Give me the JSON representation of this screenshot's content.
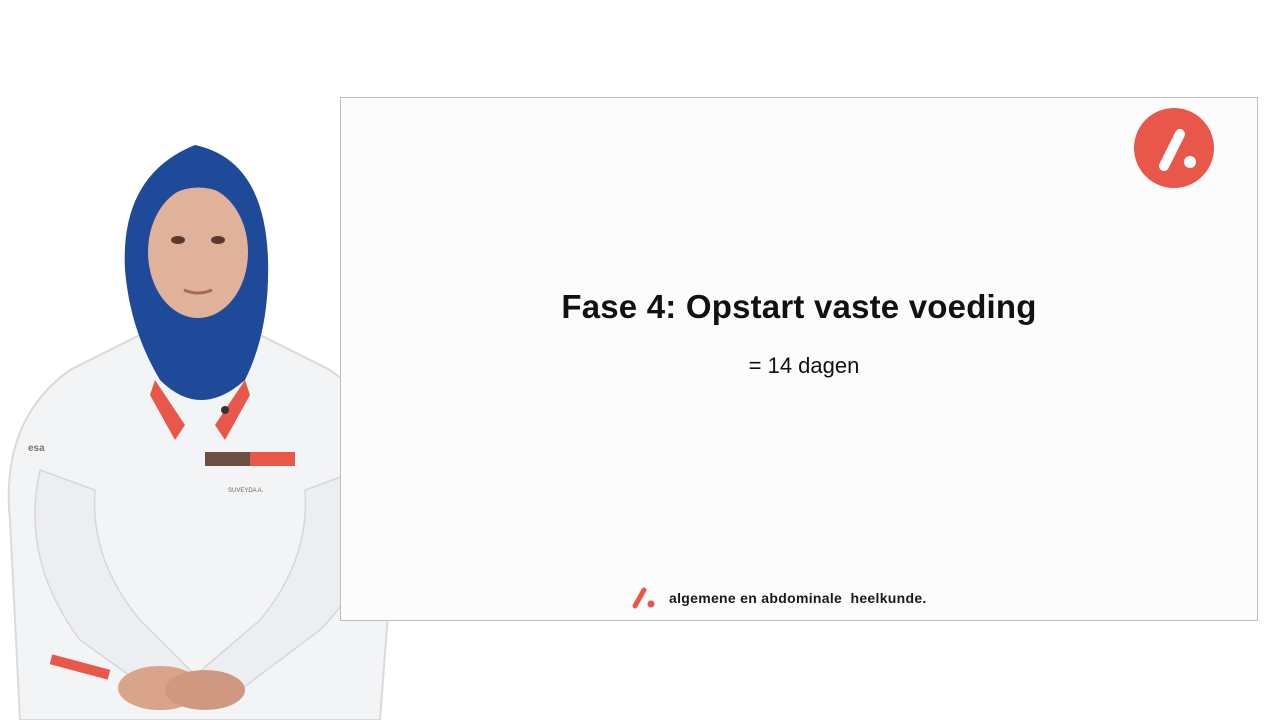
{
  "slide": {
    "title": "Fase 4: Opstart vaste voeding",
    "subtitle": "= 14 dagen",
    "footer_text": "algemene en abdominale  heelkunde."
  },
  "presenter": {
    "badge_name": "SUVEYDA A.",
    "logo_text": "esa"
  },
  "colors": {
    "accent": "#e8574a",
    "hijab": "#1f4a9a",
    "coat": "#f3f4f6",
    "slide_background": "#fcfcfd"
  },
  "icons": {
    "slide_logo": "brand-slash-dot-icon",
    "footer_logo": "brand-slash-dot-icon"
  }
}
